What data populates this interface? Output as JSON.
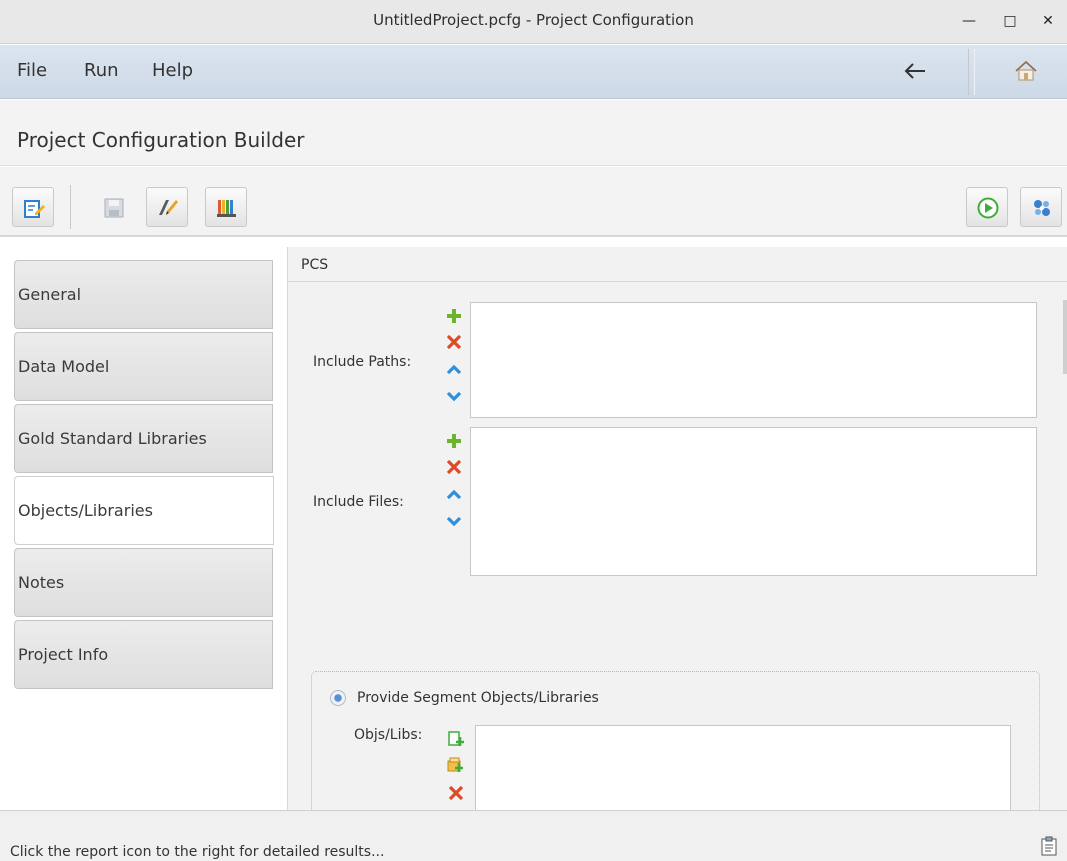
{
  "window": {
    "title": "UntitledProject.pcfg - Project Configuration"
  },
  "menu": [
    "File",
    "Run",
    "Help"
  ],
  "page": {
    "title": "Project Configuration Builder"
  },
  "toolbar": {
    "left": [
      "edit-config-icon",
      "save-icon",
      "pencil-icon",
      "columns-icon"
    ],
    "right": [
      "run-icon",
      "settings-icon"
    ]
  },
  "tabs": [
    "General",
    "Data Model",
    "Gold Standard Libraries",
    "Objects/Libraries",
    "Notes",
    "Project Info"
  ],
  "active_tab": "Objects/Libraries",
  "section": {
    "title": "PCS",
    "include_paths_label": "Include Paths:",
    "include_files_label": "Include Files:",
    "segment_option_label": "Provide Segment Objects/Libraries",
    "objs_libs_label": "Objs/Libs:"
  },
  "status": {
    "text": "Click the report icon to the right for detailed results..."
  },
  "colors": {
    "accent_blue": "#2f8fd8",
    "add_green": "#6cb52a",
    "remove_red": "#dd4a2a",
    "run_green": "#3cad3c"
  }
}
